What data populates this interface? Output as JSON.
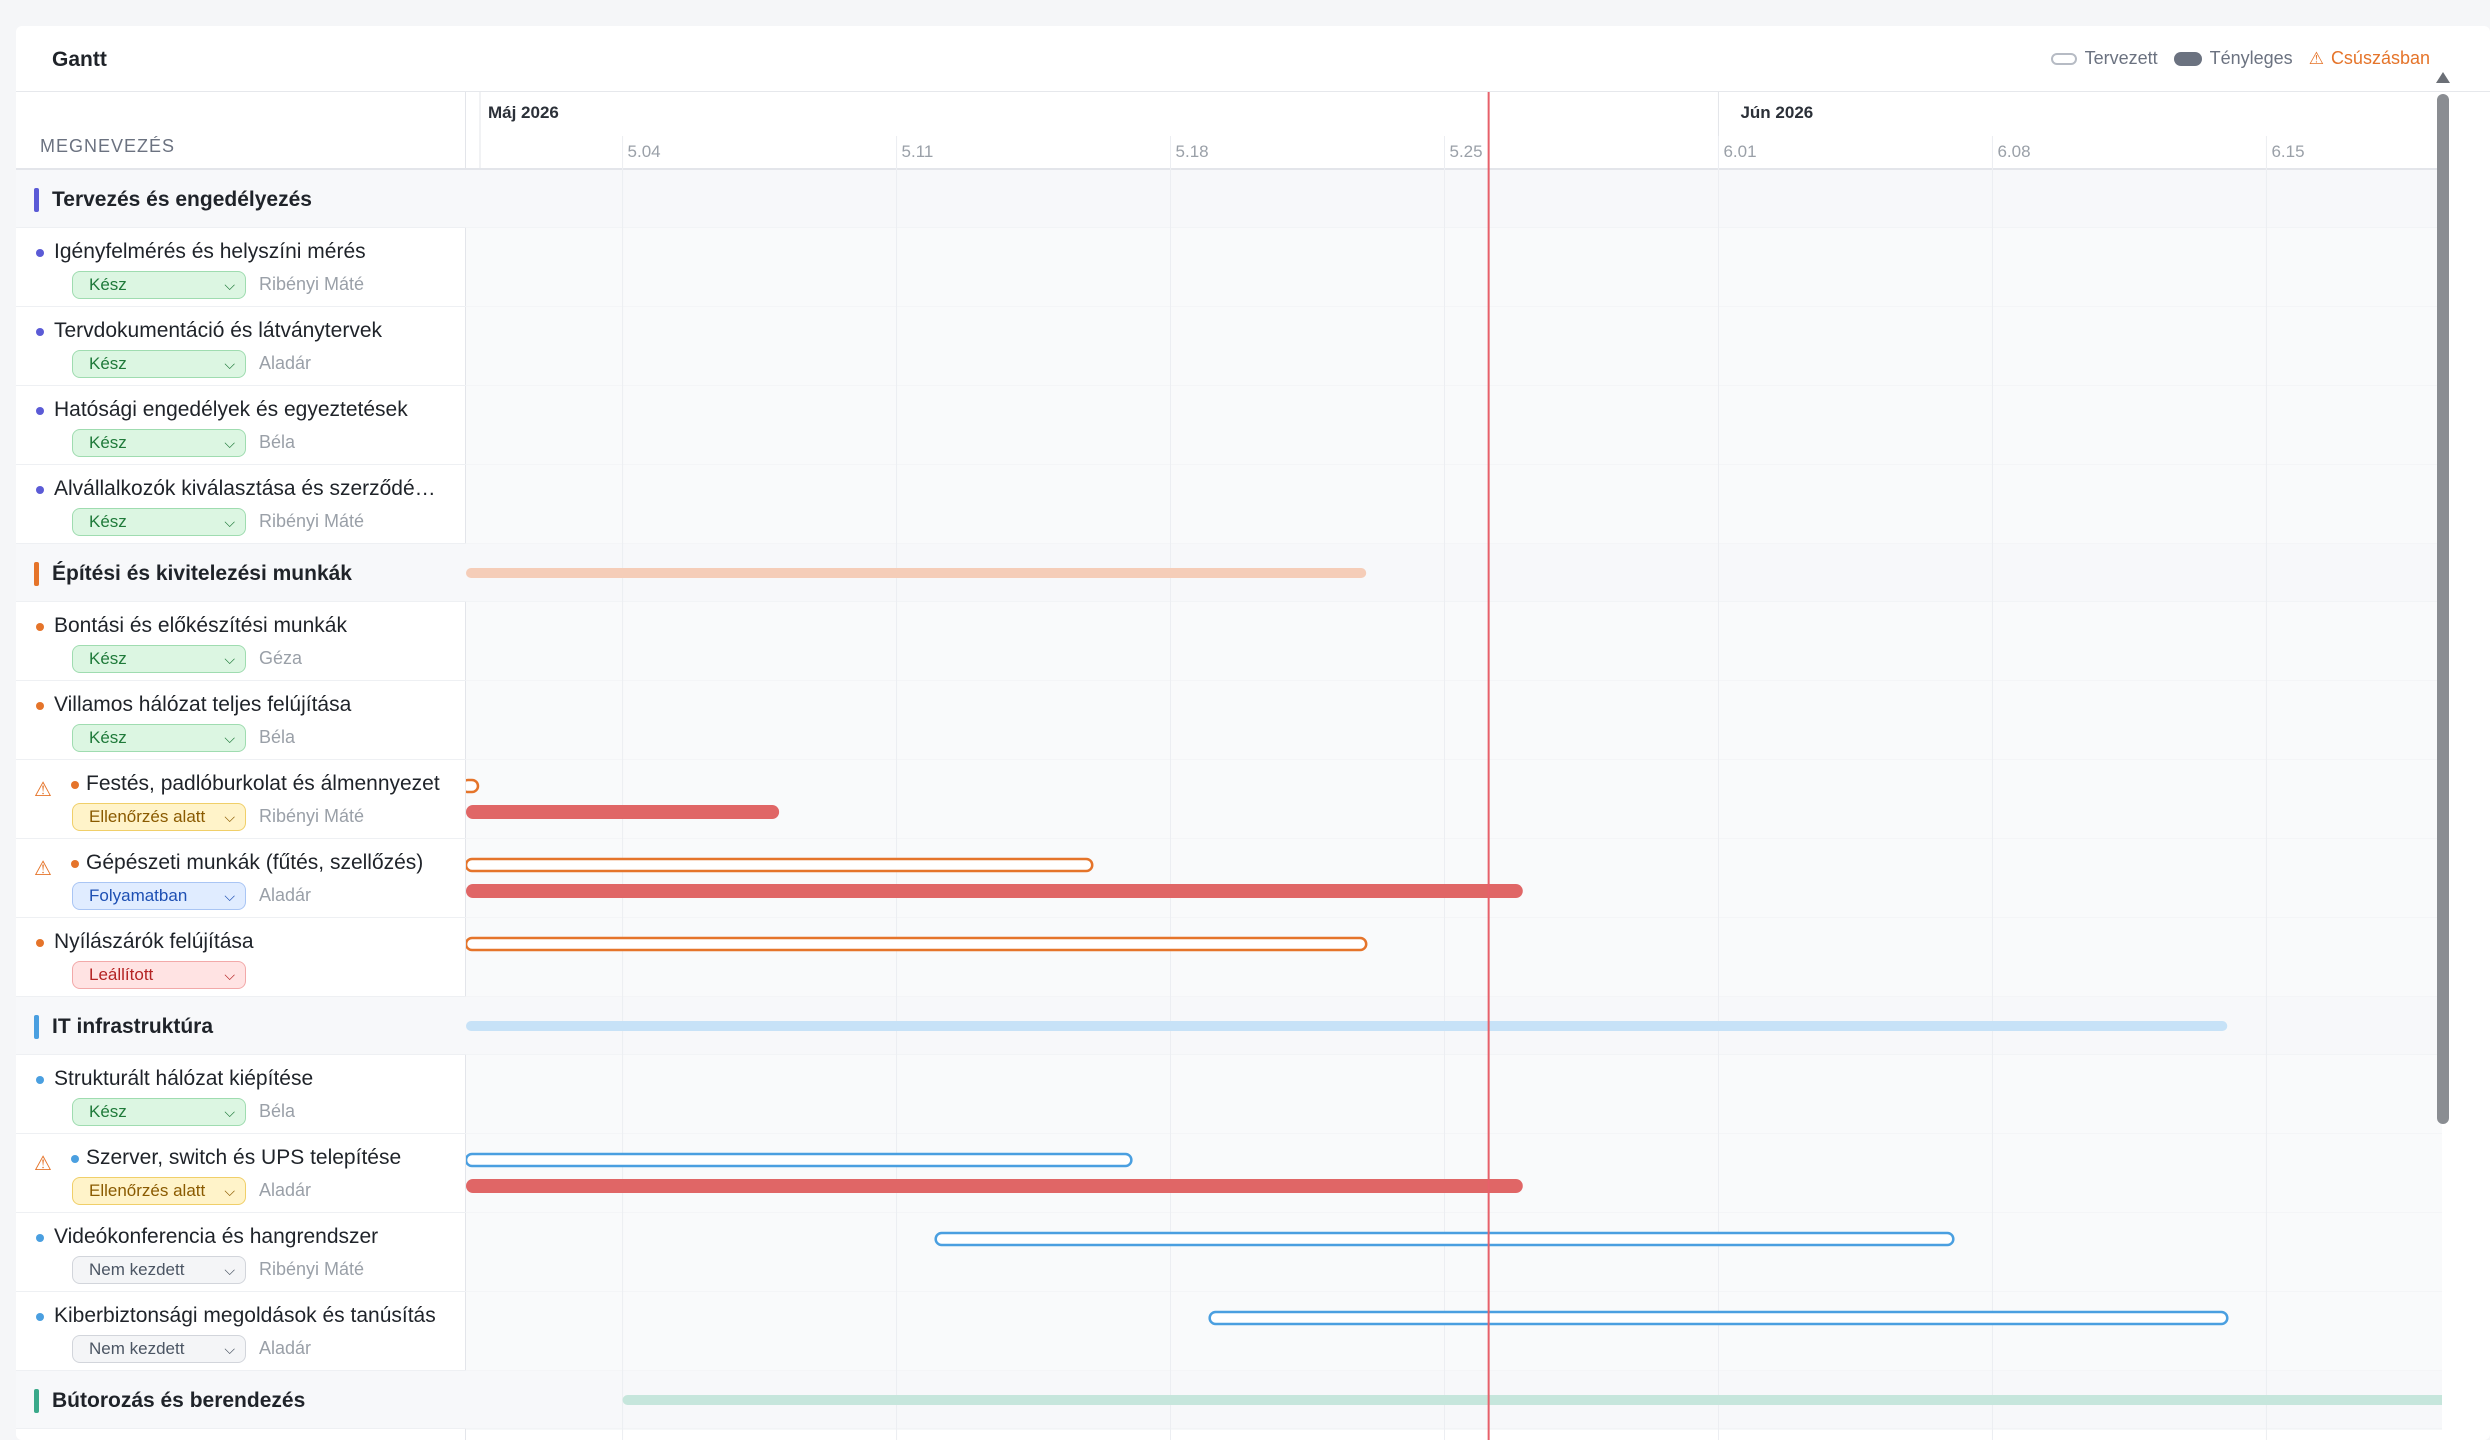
{
  "app": {
    "title": "Gantt",
    "legend": {
      "planned": "Tervezett",
      "actual": "Tényleges",
      "slipping": "Csúszásban"
    },
    "column_header": "MEGNEVEZÉS",
    "colors": {
      "today_line": "#e7606a",
      "slipping": "#e5742a",
      "actual_bar": "#e06666"
    }
  },
  "timeline": {
    "start": "2026-04-30",
    "end": "2026-06-21",
    "today": "2026-05-26",
    "months": [
      {
        "label": "Máj 2026",
        "date": "2026-04-30"
      },
      {
        "label": "Jún 2026",
        "date": "2026-06-01"
      }
    ],
    "weeks": [
      {
        "label": "5.04",
        "date": "2026-05-04"
      },
      {
        "label": "5.11",
        "date": "2026-05-11"
      },
      {
        "label": "5.18",
        "date": "2026-05-18"
      },
      {
        "label": "5.25",
        "date": "2026-05-25"
      },
      {
        "label": "6.01",
        "date": "2026-06-01"
      },
      {
        "label": "6.08",
        "date": "2026-06-08"
      },
      {
        "label": "6.15",
        "date": "2026-06-15"
      }
    ]
  },
  "groups": [
    {
      "name": "Tervezés és engedélyezés",
      "color": "#5b5bd6",
      "bar": null,
      "tasks": [
        {
          "name": "Igényfelmérés és helyszíni mérés",
          "status": "Kész",
          "status_type": "done",
          "owner": "Ribényi Máté",
          "slipping": false,
          "planned": null,
          "actual": null
        },
        {
          "name": "Tervdokumentáció és látványtervek",
          "status": "Kész",
          "status_type": "done",
          "owner": "Aladár",
          "slipping": false,
          "planned": null,
          "actual": null
        },
        {
          "name": "Hatósági engedélyek és egyeztetések",
          "status": "Kész",
          "status_type": "done",
          "owner": "Béla",
          "slipping": false,
          "planned": null,
          "actual": null
        },
        {
          "name": "Alvállalkozók kiválasztása és szerződé…",
          "status": "Kész",
          "status_type": "done",
          "owner": "Ribényi Máté",
          "slipping": false,
          "planned": null,
          "actual": null
        }
      ]
    },
    {
      "name": "Építési és kivitelezési munkák",
      "color": "#e5742a",
      "bar": [
        "2026-04-30",
        "2026-05-23"
      ],
      "bar_color": "#f5cdb8",
      "tasks": [
        {
          "name": "Bontási és előkészítési munkák",
          "status": "Kész",
          "status_type": "done",
          "owner": "Géza",
          "slipping": false,
          "planned": null,
          "actual": null
        },
        {
          "name": "Villamos hálózat teljes felújítása",
          "status": "Kész",
          "status_type": "done",
          "owner": "Béla",
          "slipping": false,
          "planned": null,
          "actual": null
        },
        {
          "name": "Festés, padlóburkolat és álmennyezet",
          "status": "Ellenőrzés alatt",
          "status_type": "review",
          "owner": "Ribényi Máté",
          "slipping": true,
          "planned": [
            "2026-04-30",
            "2026-04-30"
          ],
          "actual": [
            "2026-04-30",
            "2026-05-08"
          ]
        },
        {
          "name": "Gépészeti munkák (fűtés, szellőzés)",
          "status": "Folyamatban",
          "status_type": "progress",
          "owner": "Aladár",
          "slipping": true,
          "planned": [
            "2026-04-30",
            "2026-05-16"
          ],
          "actual": [
            "2026-04-30",
            "2026-05-27"
          ]
        },
        {
          "name": "Nyílászárók felújítása",
          "status": "Leállított",
          "status_type": "stopped",
          "owner": "",
          "slipping": false,
          "planned": [
            "2026-04-30",
            "2026-05-23"
          ],
          "actual": null
        }
      ]
    },
    {
      "name": "IT infrastruktúra",
      "color": "#4a9fe0",
      "bar": [
        "2026-04-30",
        "2026-06-14"
      ],
      "bar_color": "#c7e2f7",
      "tasks": [
        {
          "name": "Strukturált hálózat kiépítése",
          "status": "Kész",
          "status_type": "done",
          "owner": "Béla",
          "slipping": false,
          "planned": null,
          "actual": null
        },
        {
          "name": "Szerver, switch és UPS telepítése",
          "status": "Ellenőrzés alatt",
          "status_type": "review",
          "owner": "Aladár",
          "slipping": true,
          "planned": [
            "2026-04-30",
            "2026-05-17"
          ],
          "actual": [
            "2026-04-30",
            "2026-05-27"
          ]
        },
        {
          "name": "Videókonferencia és hangrendszer",
          "status": "Nem kezdett",
          "status_type": "none",
          "owner": "Ribényi Máté",
          "slipping": false,
          "planned": [
            "2026-05-12",
            "2026-06-07"
          ],
          "actual": null
        },
        {
          "name": "Kiberbiztonsági megoldások és tanúsítás",
          "status": "Nem kezdett",
          "status_type": "none",
          "owner": "Aladár",
          "slipping": false,
          "planned": [
            "2026-05-19",
            "2026-06-14"
          ],
          "actual": null
        }
      ]
    },
    {
      "name": "Bútorozás és berendezés",
      "color": "#3aa98a",
      "bar": [
        "2026-05-04",
        "2026-06-21"
      ],
      "bar_color": "#c6e6dc",
      "tasks": []
    }
  ]
}
